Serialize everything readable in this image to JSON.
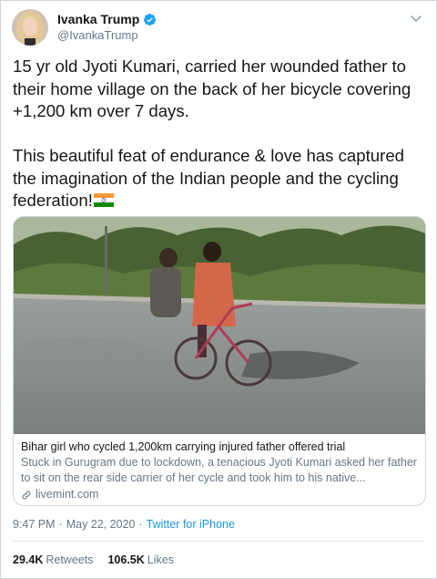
{
  "author": {
    "display_name": "Ivanka Trump",
    "handle": "@IvankaTrump",
    "verified_icon": "verified-badge-icon",
    "avatar_icon": "avatar-icon"
  },
  "tweet": {
    "paragraph_1": "15 yr old Jyoti Kumari, carried her wounded father to their home village on the back of her bicycle covering +1,200 km over 7 days.",
    "paragraph_2": "This beautiful feat of endurance & love has captured the imagination of the Indian people and the cycling federation!",
    "emoji": "india-flag-icon"
  },
  "card": {
    "title": "Bihar girl who cycled 1,200km carrying injured father offered trial",
    "description": "Stuck in Gurugram due to lockdown, a tenacious Jyoti Kumari asked her father to sit on the rear side carrier of her cycle and took him to his native...",
    "domain": "livemint.com"
  },
  "meta": {
    "time": "9:47 PM",
    "separator_1": "·",
    "date": "May 22, 2020",
    "separator_2": "·",
    "source": "Twitter for iPhone"
  },
  "stats": {
    "retweets_count": "29.4K",
    "retweets_label": "Retweets",
    "likes_count": "106.5K",
    "likes_label": "Likes"
  },
  "colors": {
    "link_blue": "#1b95e0",
    "secondary_gray": "#657786",
    "text_dark": "#14171a"
  }
}
